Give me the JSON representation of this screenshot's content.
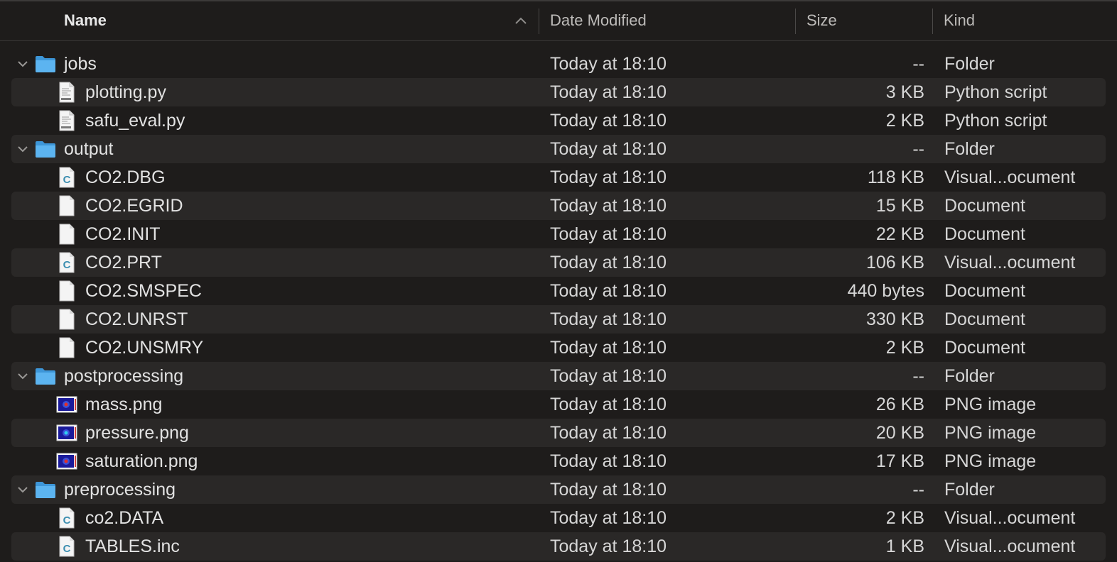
{
  "header": {
    "name": "Name",
    "date": "Date Modified",
    "size": "Size",
    "kind": "Kind"
  },
  "rows": [
    {
      "type": "folder",
      "name": "jobs",
      "date": "Today at 18:10",
      "size": "--",
      "kind": "Folder"
    },
    {
      "type": "file",
      "icon": "python",
      "name": "plotting.py",
      "date": "Today at 18:10",
      "size": "3 KB",
      "kind": "Python script"
    },
    {
      "type": "file",
      "icon": "python",
      "name": "safu_eval.py",
      "date": "Today at 18:10",
      "size": "2 KB",
      "kind": "Python script"
    },
    {
      "type": "folder",
      "name": "output",
      "date": "Today at 18:10",
      "size": "--",
      "kind": "Folder"
    },
    {
      "type": "file",
      "icon": "c",
      "name": "CO2.DBG",
      "date": "Today at 18:10",
      "size": "118 KB",
      "kind": "Visual...ocument"
    },
    {
      "type": "file",
      "icon": "doc",
      "name": "CO2.EGRID",
      "date": "Today at 18:10",
      "size": "15 KB",
      "kind": "Document"
    },
    {
      "type": "file",
      "icon": "doc",
      "name": "CO2.INIT",
      "date": "Today at 18:10",
      "size": "22 KB",
      "kind": "Document"
    },
    {
      "type": "file",
      "icon": "c",
      "name": "CO2.PRT",
      "date": "Today at 18:10",
      "size": "106 KB",
      "kind": "Visual...ocument"
    },
    {
      "type": "file",
      "icon": "doc",
      "name": "CO2.SMSPEC",
      "date": "Today at 18:10",
      "size": "440 bytes",
      "kind": "Document"
    },
    {
      "type": "file",
      "icon": "doc",
      "name": "CO2.UNRST",
      "date": "Today at 18:10",
      "size": "330 KB",
      "kind": "Document"
    },
    {
      "type": "file",
      "icon": "doc",
      "name": "CO2.UNSMRY",
      "date": "Today at 18:10",
      "size": "2 KB",
      "kind": "Document"
    },
    {
      "type": "folder",
      "name": "postprocessing",
      "date": "Today at 18:10",
      "size": "--",
      "kind": "Folder"
    },
    {
      "type": "file",
      "icon": "png-red",
      "name": "mass.png",
      "date": "Today at 18:10",
      "size": "26 KB",
      "kind": "PNG image"
    },
    {
      "type": "file",
      "icon": "png-cyan",
      "name": "pressure.png",
      "date": "Today at 18:10",
      "size": "20 KB",
      "kind": "PNG image"
    },
    {
      "type": "file",
      "icon": "png-red",
      "name": "saturation.png",
      "date": "Today at 18:10",
      "size": "17 KB",
      "kind": "PNG image"
    },
    {
      "type": "folder",
      "name": "preprocessing",
      "date": "Today at 18:10",
      "size": "--",
      "kind": "Folder"
    },
    {
      "type": "file",
      "icon": "c",
      "name": "co2.DATA",
      "date": "Today at 18:10",
      "size": "2 KB",
      "kind": "Visual...ocument"
    },
    {
      "type": "file",
      "icon": "c",
      "name": "TABLES.inc",
      "date": "Today at 18:10",
      "size": "1 KB",
      "kind": "Visual...ocument"
    }
  ],
  "colors": {
    "folder": "#5cb4f0",
    "folder_dark": "#3d96d8",
    "c_letter": "#3b8eb0"
  }
}
